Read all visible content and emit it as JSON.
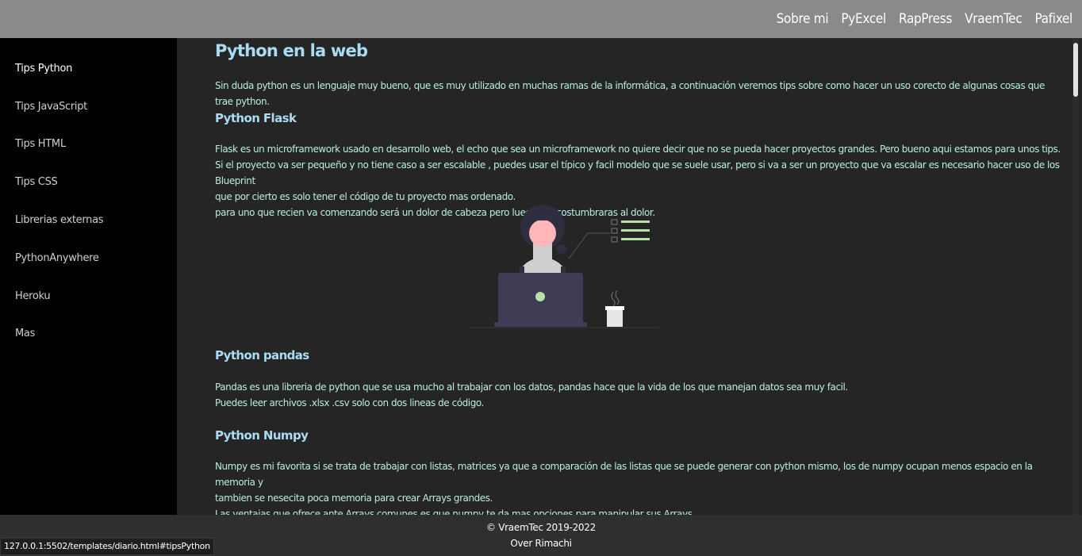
{
  "topnav": {
    "items": [
      "Sobre mi",
      "PyExcel",
      "RapPress",
      "VraemTec",
      "Pafixel"
    ]
  },
  "sidebar": {
    "items": [
      {
        "label": "Tips Python"
      },
      {
        "label": "Tips JavaScript"
      },
      {
        "label": "Tips HTML"
      },
      {
        "label": "Tips CSS"
      },
      {
        "label": "Librerias externas"
      },
      {
        "label": "PythonAnywhere"
      },
      {
        "label": "Heroku"
      },
      {
        "label": "Mas"
      }
    ]
  },
  "main": {
    "title": "Python en la web",
    "intro": "Sin duda python es un lenguaje muy bueno, que es muy utilizado en muchas ramas de la informática, a continuación veremos tips sobre como hacer un uso corecto de algunas cosas que trae python.",
    "sections": [
      {
        "heading": "Python Flask",
        "lines": [
          "Flask es un microframework usado en desarrollo web, el echo que sea un microframework no quiere decir que no se pueda hacer proyectos grandes. Pero bueno aqui estamos para unos tips.",
          "Si el proyecto va ser pequeño y no tiene caso a ser escalable , puedes usar el típico y facil modelo que se suele usar, pero si va a ser un proyecto que va escalar es necesario hacer uso de los Blueprint",
          "que por cierto es solo tener el código de tu proyecto mas ordenado.",
          "para uno que recien va comenzando será un dolor de cabeza pero luego te acostumbraras al dolor."
        ]
      },
      {
        "heading": "Python pandas",
        "lines": [
          "Pandas es una libreria de python que se usa mucho al trabajar con los datos, pandas hace que la vida de los que manejan datos sea muy facil.",
          "Puedes leer archivos .xlsx .csv solo con dos lineas de código."
        ]
      },
      {
        "heading": "Python Numpy",
        "lines": [
          "Numpy es mi favorita si se trata de trabajar con listas, matrices ya que a comparación de las listas que se puede generar con python mismo, los de numpy ocupan menos espacio en la memoria y",
          "tambien se nesecita poca memoria para crear Arrays grandes.",
          "Las ventajas que ofrece ante Arrays comunes es que numpy te da mas opciones para manipular sus Arrays"
        ]
      }
    ]
  },
  "footer": {
    "copyright": "© VraemTec 2019-2022",
    "author": "Over Rimachi"
  },
  "statusbar": {
    "url": "127.0.0.1:5502/templates/diario.html#tipsPython"
  },
  "colors": {
    "topbar": "#8a8a8a",
    "sidebar": "#000000",
    "content_bg": "#252525",
    "heading": "#a9dcf2",
    "text": "#b9ece2",
    "accent_green": "#b6e3a5",
    "laptop": "#3f3d56"
  },
  "illustration": {
    "icon": "person-at-laptop-illustration"
  }
}
